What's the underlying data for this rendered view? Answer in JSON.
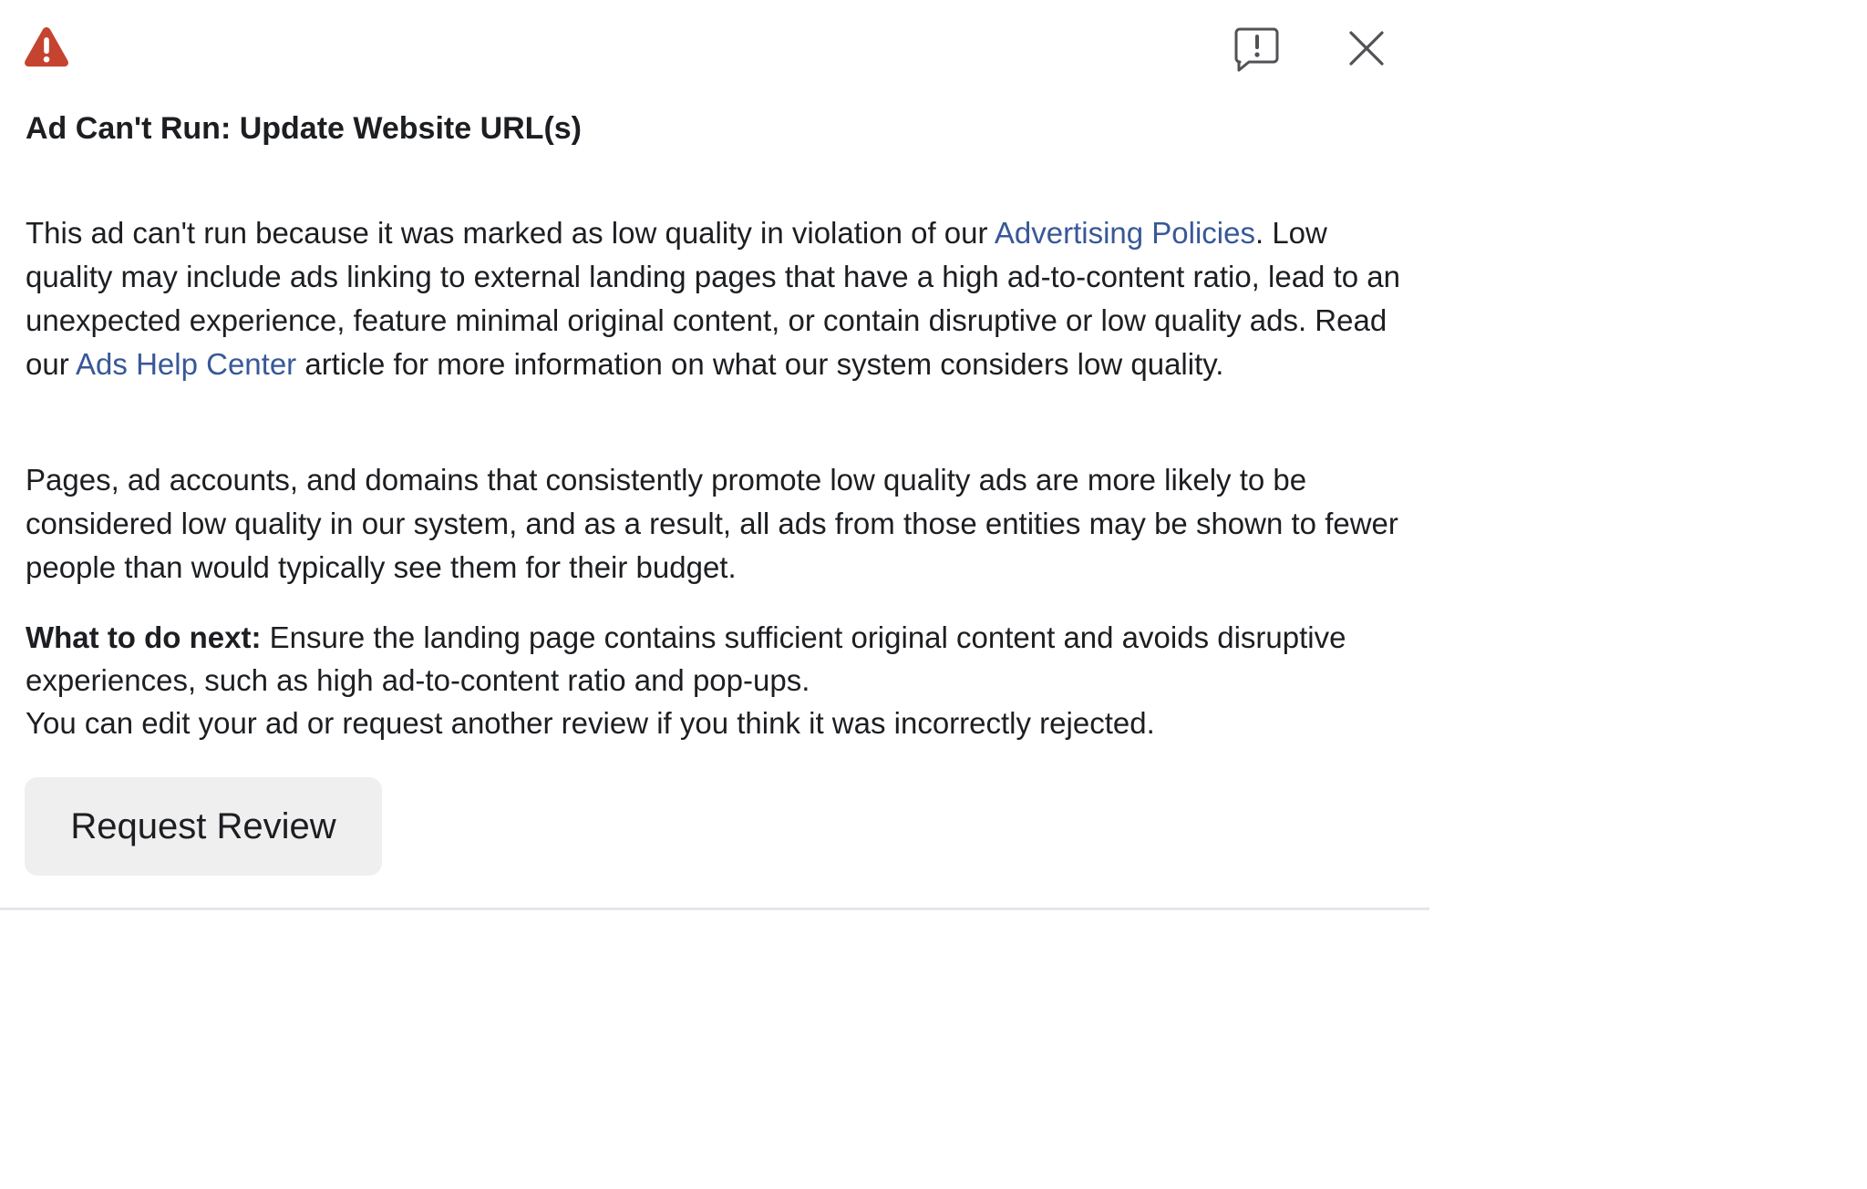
{
  "colors": {
    "warning_red": "#c5442f",
    "link_blue": "#385898",
    "text": "#1c1e21",
    "button_bg": "#efefef",
    "icon_gray": "#505256"
  },
  "header": {
    "warning_icon": "warning-triangle-icon",
    "feedback_icon": "report-feedback-icon",
    "close_icon": "close-icon"
  },
  "title": "Ad Can't Run: Update Website URL(s)",
  "body": {
    "p1": {
      "text_before_policies_link": "This ad can't run because it was marked as low quality in violation of our ",
      "policies_link_label": "Advertising Policies",
      "text_after_policies_link": ". Low quality may include ads linking to external landing pages that have a high ad-to-content ratio, lead to an unexpected experience, feature minimal original content, or contain disruptive or low quality ads. Read our ",
      "help_link_label": "Ads Help Center",
      "text_after_help_link": " article for more information on what our system considers low quality."
    },
    "p2": "Pages, ad accounts, and domains that consistently promote low quality ads are more likely to be considered low quality in our system, and as a result, all ads from those entities may be shown to fewer people than would typically see them for their budget.",
    "p3": {
      "label": "What to do next:",
      "line1": " Ensure the landing page contains sufficient original content and avoids disruptive experiences, such as high ad-to-content ratio and pop-ups.",
      "line2": "You can edit your ad or request another review if you think it was incorrectly rejected."
    }
  },
  "actions": {
    "request_review_label": "Request Review"
  }
}
